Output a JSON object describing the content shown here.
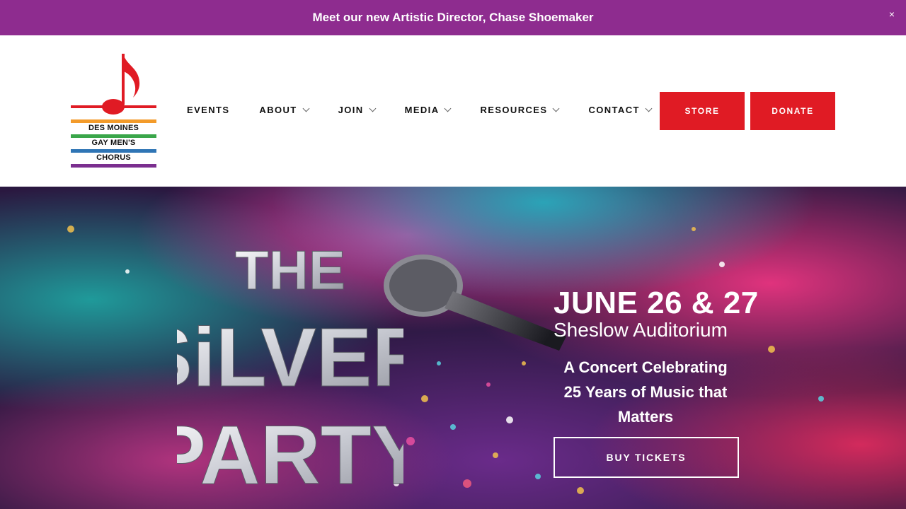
{
  "announcement": {
    "text": "Meet our new Artistic Director, Chase Shoemaker",
    "close_label": "×"
  },
  "logo": {
    "lines": [
      "DES MOINES",
      "GAY MEN'S",
      "CHORUS"
    ],
    "stripe_colors": [
      "#f39b2a",
      "#3aa64a",
      "#2f75b5",
      "#7b2f8f"
    ],
    "note_color": "#e01b24"
  },
  "nav": {
    "items": [
      {
        "label": "EVENTS",
        "has_dropdown": false
      },
      {
        "label": "ABOUT",
        "has_dropdown": true
      },
      {
        "label": "JOIN",
        "has_dropdown": true
      },
      {
        "label": "MEDIA",
        "has_dropdown": true
      },
      {
        "label": "RESOURCES",
        "has_dropdown": true
      },
      {
        "label": "CONTACT",
        "has_dropdown": true
      }
    ],
    "store_label": "STORE",
    "donate_label": "DONATE"
  },
  "hero": {
    "title_lines": [
      "THE",
      "SiLVER",
      "PARTY"
    ],
    "date": "JUNE 26 & 27",
    "venue": "Sheslow Auditorium",
    "tagline": "A Concert Celebrating 25 Years of Music that Matters",
    "button_label": "BUY TICKETS"
  },
  "colors": {
    "announcement_bg": "#8e2c8f",
    "accent_red": "#e01b24"
  }
}
